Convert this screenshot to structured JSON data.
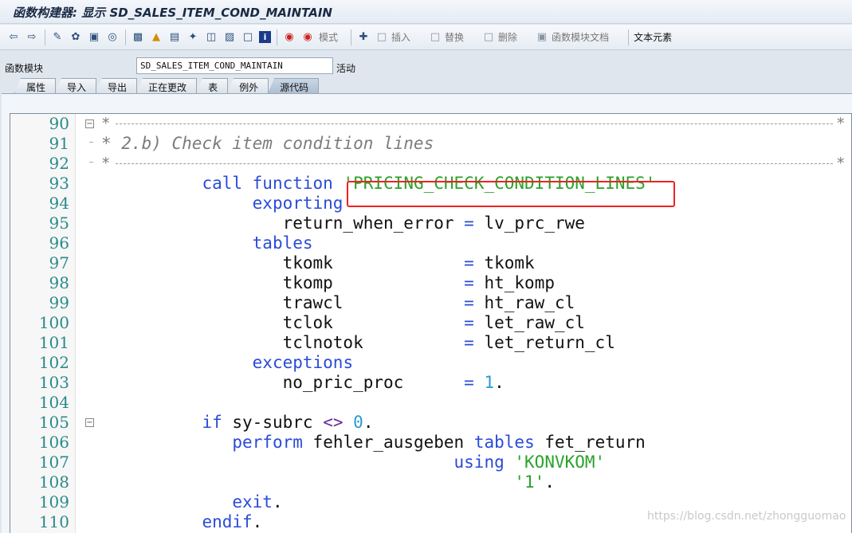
{
  "window": {
    "title": "函数构建器: 显示 SD_SALES_ITEM_COND_MAINTAIN"
  },
  "toolbar": {
    "icons": [
      "back-arrow-icon",
      "forward-arrow-icon",
      "display-change-icon",
      "active-inactive-icon",
      "other-object-icon",
      "check-icon",
      "activate-icon",
      "where-used-icon",
      "test-icon",
      "navigate-icon",
      "hierarchy-icon",
      "object-list-icon",
      "display-object-icon",
      "info-icon",
      "stop-icon",
      "breakpoint-icon"
    ],
    "pattern_label": "模式",
    "insert_label": "插入",
    "replace_label": "替换",
    "delete_label": "删除",
    "fm_doc_label": "函数模块文档",
    "text_elements_label": "文本元素"
  },
  "header": {
    "fm_label": "函数模块",
    "fm_value": "SD_SALES_ITEM_COND_MAINTAIN",
    "status": "活动"
  },
  "tabs": [
    {
      "label": "属性",
      "active": false
    },
    {
      "label": "导入",
      "active": false
    },
    {
      "label": "导出",
      "active": false
    },
    {
      "label": "正在更改",
      "active": false
    },
    {
      "label": "表",
      "active": false
    },
    {
      "label": "例外",
      "active": false
    },
    {
      "label": "源代码",
      "active": true
    }
  ],
  "editor": {
    "line_numbers": [
      "90",
      "91",
      "92",
      "93",
      "94",
      "95",
      "96",
      "97",
      "98",
      "99",
      "100",
      "101",
      "102",
      "103",
      "104",
      "105",
      "106",
      "107",
      "108",
      "109",
      "110"
    ],
    "comment_star": "*",
    "comment_91": "* 2.b) Check item condition lines",
    "l93_kw": "call function",
    "l93_str": "'PRICING_CHECK_CONDITION_LINES'",
    "l94_kw": "exporting",
    "l95_param": "return_when_error",
    "l95_val": "lv_prc_rwe",
    "l96_kw": "tables",
    "l97_param": "tkomk",
    "l97_val": "tkomk",
    "l98_param": "tkomp",
    "l98_val": "ht_komp",
    "l99_param": "trawcl",
    "l99_val": "ht_raw_cl",
    "l100_param": "tclok",
    "l100_val": "let_raw_cl",
    "l101_param": "tclnotok",
    "l101_val": "let_return_cl",
    "l102_kw": "exceptions",
    "l103_param": "no_pric_proc",
    "l103_num": "1",
    "l105_kw": "if",
    "l105_var": "sy-subrc",
    "l105_op": "<>",
    "l105_num": "0",
    "l106_kw1": "perform",
    "l106_name": "fehler_ausgeben",
    "l106_kw2": "tables",
    "l106_var": "fet_return",
    "l107_kw": "using",
    "l107_str": "'KONVKOM'",
    "l108_str": "'1'",
    "l109_kw": "exit",
    "l110_kw": "endif",
    "eq": "=",
    "dot": "."
  },
  "watermark": "https://blog.csdn.net/zhongguomao",
  "colors": {
    "keyword": "#2a4bd7",
    "string": "#2aa22a",
    "number": "#2a9ad0",
    "comment": "#7c7c7c",
    "line_number": "#2a8a8a",
    "highlight": "#ee2222"
  }
}
